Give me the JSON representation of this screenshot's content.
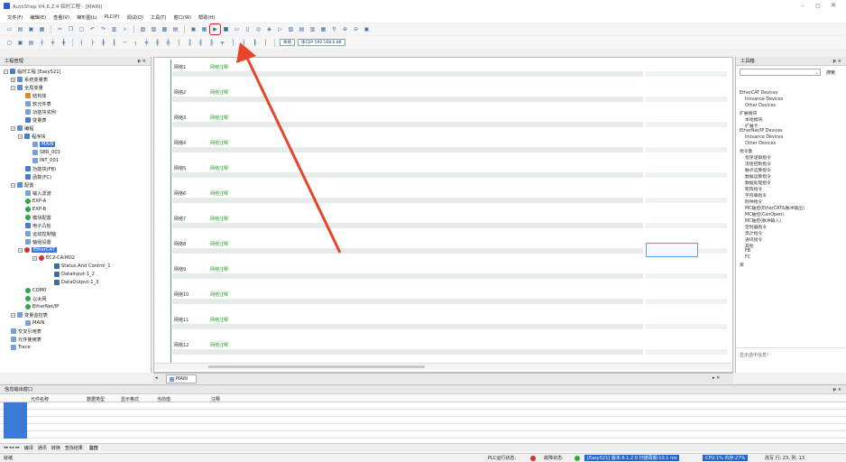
{
  "app": {
    "title": "AutoShop V4.6.2.4 临时工程 - [MAIN]"
  },
  "window": {
    "min": "–",
    "max": "◻",
    "close": "✕"
  },
  "menu": [
    "文件(F)",
    "编辑(E)",
    "查看(V)",
    "梯形图(L)",
    "PLC(P)",
    "调试(D)",
    "工具(T)",
    "窗口(W)",
    "帮助(H)"
  ],
  "toolbar": {
    "comm_mode": "本地",
    "ip_label": "串口IP 192.168.0.88"
  },
  "project_panel": {
    "title": "工程管理",
    "pin": "ᵽ ×",
    "nodes": [
      "临时工程 [Easy521]",
      "系统变量表",
      "全局变量",
      "结构体",
      "软元件表",
      "功能块实例",
      "变量表",
      "编程",
      "程序块",
      "MAIN",
      "SBR_001",
      "INT_001",
      "功能块(FB)",
      "函数(FC)",
      "配置",
      "输入滤波",
      "EXP-A",
      "EXP-B",
      "模块配置",
      "电子凸轮",
      "运动控制轴",
      "轴组设置",
      "EtherCAT",
      "EC2-CA-M02",
      "Status And Control_1",
      "DataInput-1_2",
      "DataOutput-1_3",
      "COM0",
      "以太网",
      "EtherNet/IP",
      "变量监控表",
      "MAIN",
      "交叉引用表",
      "元件使用表",
      "Trace"
    ]
  },
  "editor": {
    "rung_prefix": "网络",
    "comment": "网络注释",
    "tab": "MAIN"
  },
  "toolbox": {
    "title": "工具箱",
    "pin": "ᵽ ×",
    "search": "搜索",
    "items": [
      "EtherCAT Devices",
      "Inovance Devices",
      "Other Devices",
      "扩展模块",
      "本地模块",
      "扩展卡",
      "EtherNet/IP Devices",
      "Inovance Devices",
      "Other Devices",
      "指令集",
      "程序逻辑指令",
      "流程控制指令",
      "触点运算指令",
      "数据运算指令",
      "数据处理指令",
      "矩阵指令",
      "字符串指令",
      "时钟指令",
      "MC轴控(EtherCAT&脉冲输出)",
      "MC轴控(CanOpen)",
      "MC轴控(脉冲输入)",
      "定时器指令",
      "高计指令",
      "通讯指令",
      "其他",
      "FB",
      "FC",
      "库"
    ],
    "hint": "显示选中信息!"
  },
  "output": {
    "title": "信息输出窗口",
    "pin": "ᵽ ×",
    "columns": [
      "元件名称",
      "数据类型",
      "显示格式",
      "当前值",
      "注释"
    ],
    "tabs": [
      "编译",
      "通讯",
      "转换",
      "查找结果",
      "监控"
    ]
  },
  "status": {
    "ready": "就绪",
    "plc_state": "PLC运行状态:",
    "fault": "故障状态:",
    "device": "[Easy521] 版本:6.1.2.0 扫描周期:10.1 ms",
    "cpu": "CPU:1% 内存:27%",
    "edit_mode": "改写 行: 23, 列: 13"
  },
  "colors": {
    "accent": "#2a63c8",
    "highlight": "#e02020",
    "arrow": "#e8442a"
  }
}
